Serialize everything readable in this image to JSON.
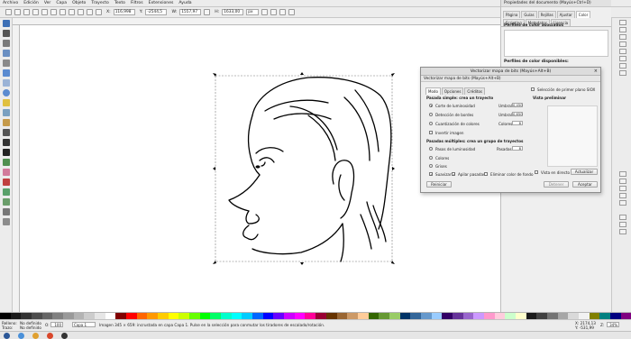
{
  "menubar": {
    "items": [
      "Archivo",
      "Edición",
      "Ver",
      "Capa",
      "Objeto",
      "Trayecto",
      "Texto",
      "Filtros",
      "Extensiones",
      "Ayuda"
    ]
  },
  "tool_controls": {
    "x_label": "X:",
    "x_value": "116,998",
    "y_label": "Y:",
    "y_value": "-2544,5",
    "w_label": "W:",
    "w_value": "1557,97",
    "h_label": "H:",
    "h_value": "1633,00",
    "unit": "px"
  },
  "doc_properties": {
    "title": "Propiedades del documento (Mayús+Ctrl+D)",
    "tabs": [
      "Página",
      "Guías",
      "Rejillas",
      "Ajustar",
      "Color",
      "Scripting",
      "Metadatos",
      "Licencia"
    ],
    "active_tab": "Color",
    "section_linked": "Perfiles de color asociados",
    "section_available": "Perfiles de color disponibles:"
  },
  "vectorize": {
    "window_title": "Vectorizar mapa de bits (Mayús+Alt+B)",
    "subtitle": "Vectorizar mapa de bits (Mayús+Alt+B)",
    "tabs": [
      "Modo",
      "Opciones",
      "Créditos"
    ],
    "single_scan_title": "Pasada simple: crea un trayecto",
    "brightness_cutoff": "Corte de luminosidad",
    "edge_detection": "Detección de bordes",
    "color_quantization": "Cuantización de colores",
    "invert_image": "Invertir imagen",
    "threshold_label": "Umbral:",
    "threshold_value": "0,450",
    "edge_threshold_label": "Umbral:",
    "edge_threshold_value": "0,650",
    "colors_label": "Colores:",
    "colors_value": "8",
    "multi_scan_title": "Pasadas múltiples: crea un grupo de trayectos",
    "brightness_steps": "Pasos de luminosidad",
    "colors": "Colores",
    "grays": "Grises",
    "steps_label": "Pasadas:",
    "steps_value": "8",
    "smooth": "Suavizar",
    "stack_scans": "Apilar pasadas",
    "remove_background": "Eliminar color de fondo",
    "reset_button": "Reiniciar",
    "sioxx": "Selección de primer plano SIOX",
    "preview_title": "Vista preliminar",
    "live_preview": "Vista en directo",
    "update_button": "Actualizar",
    "stop_button": "Detener",
    "accept_button": "Aceptar"
  },
  "palette": {
    "colors": [
      "#000000",
      "#1a1a1a",
      "#333333",
      "#4d4d4d",
      "#666666",
      "#808080",
      "#999999",
      "#b3b3b3",
      "#cccccc",
      "#e6e6e6",
      "#ffffff",
      "#800000",
      "#ff0000",
      "#ff6600",
      "#ff9900",
      "#ffcc00",
      "#ffff00",
      "#ccff00",
      "#66ff00",
      "#00ff00",
      "#00ff66",
      "#00ffcc",
      "#00ffff",
      "#00ccff",
      "#0066ff",
      "#0000ff",
      "#6600ff",
      "#cc00ff",
      "#ff00ff",
      "#ff0099",
      "#990033",
      "#663300",
      "#996633",
      "#cc9966",
      "#ffcc99",
      "#336600",
      "#669933",
      "#99cc66",
      "#003366",
      "#336699",
      "#6699cc",
      "#99ccff",
      "#330066",
      "#663399",
      "#9966cc",
      "#cc99ff",
      "#ff99cc",
      "#ffccdd",
      "#ccffcc",
      "#ffffcc",
      "#1a1a1a",
      "#404040",
      "#737373",
      "#a6a6a6",
      "#d9d9d9",
      "#f2f2f2",
      "#808000",
      "#008080",
      "#000080",
      "#800080"
    ]
  },
  "status": {
    "fill_label": "Relleno:",
    "fill_value": "No definido",
    "stroke_label": "Trazo:",
    "stroke_value": "No definido",
    "opacity_label": "O:",
    "opacity_value": "100",
    "layer_value": "Capa 1",
    "message": "Imagen 345 × 659: incrustada en capa Capa 1. Pulse en la selección para conmutar los tiradores de escalado/rotación.",
    "coords_x": "X: 2174,13",
    "coords_y": "Y: -531,99",
    "zoom_label": "Z:",
    "zoom_value": "34%"
  }
}
